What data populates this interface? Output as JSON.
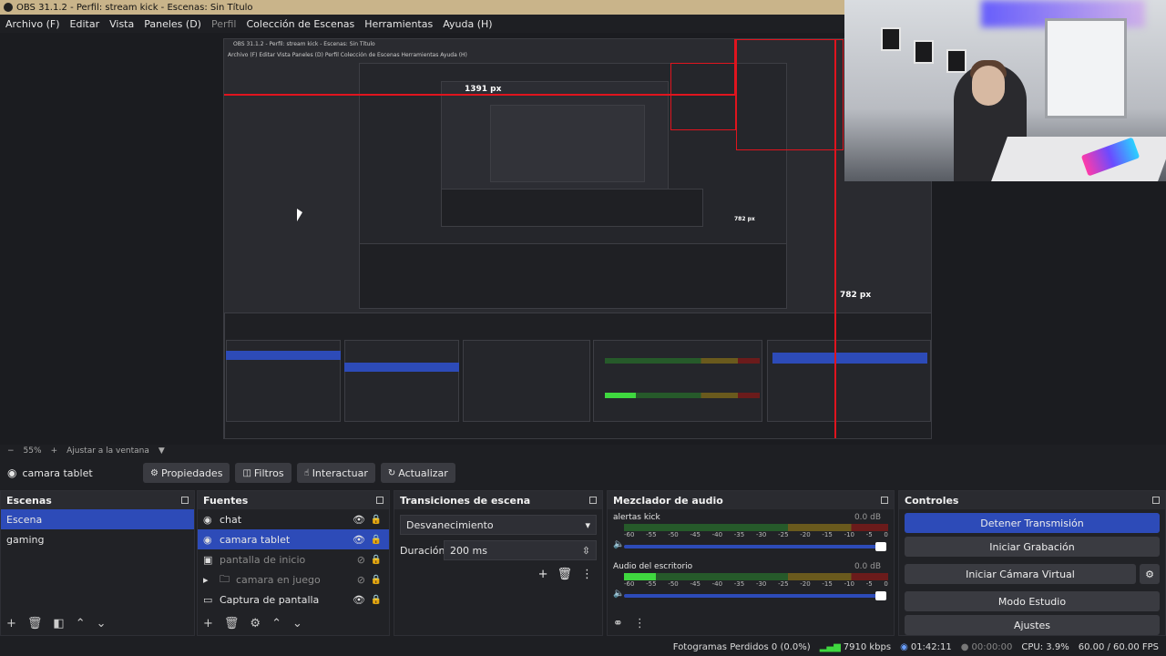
{
  "window": {
    "title": "OBS 31.1.2 - Perfil: stream kick - Escenas: Sin Título"
  },
  "menu": [
    "Archivo (F)",
    "Editar",
    "Vista",
    "Paneles (D)",
    "Perfil",
    "Colección de Escenas",
    "Herramientas",
    "Ayuda (H)"
  ],
  "preview": {
    "measure_h": "1391 px",
    "measure_v1": "782 px",
    "measure_v2": "782 px",
    "nested_title": "OBS 31.1.2 - Perfil: stream kick - Escenas: Sin Título",
    "nested_menu": "Archivo (F)   Editar   Vista   Paneles (D)   Perfil   Colección de Escenas   Herramientas   Ayuda (H)"
  },
  "zoom": {
    "minus": "−",
    "value": "55%",
    "plus": "+",
    "fit": "Ajustar a la ventana",
    "arrow": "▼"
  },
  "source_toolbar": {
    "current": "camara tablet",
    "properties": "Propiedades",
    "filters": "Filtros",
    "interact": "Interactuar",
    "refresh": "Actualizar"
  },
  "scenes": {
    "title": "Escenas",
    "items": [
      "Escena",
      "gaming"
    ]
  },
  "sources": {
    "title": "Fuentes",
    "items": [
      "chat",
      "camara tablet",
      "pantalla de inicio",
      "camara en juego",
      "Captura de pantalla"
    ]
  },
  "transitions": {
    "title": "Transiciones de escena",
    "type": "Desvanecimiento",
    "duration_label": "Duración",
    "duration": "200 ms"
  },
  "mixer": {
    "title": "Mezclador de audio",
    "channels": [
      {
        "name": "alertas kick",
        "db": "0.0 dB",
        "level": 0.0
      },
      {
        "name": "Audio del escritorio",
        "db": "0.0 dB",
        "level": 0.12
      }
    ],
    "scale": [
      "-60",
      "-55",
      "-50",
      "-45",
      "-40",
      "-35",
      "-30",
      "-25",
      "-20",
      "-15",
      "-10",
      "-5",
      "0"
    ]
  },
  "controls": {
    "title": "Controles",
    "stop_stream": "Detener Transmisión",
    "start_record": "Iniciar Grabación",
    "start_vcam": "Iniciar Cámara Virtual",
    "studio": "Modo Estudio",
    "settings": "Ajustes"
  },
  "status": {
    "dropped": "Fotogramas Perdidos 0 (0.0%)",
    "kbps": "7910 kbps",
    "stream_time": "01:42:11",
    "rec_time": "00:00:00",
    "cpu": "CPU: 3.9%",
    "fps": "60.00 / 60.00 FPS"
  },
  "colors": {
    "accent": "#2d4bb8",
    "measure": "#e0141e",
    "titlebar": "#c9b48a"
  }
}
